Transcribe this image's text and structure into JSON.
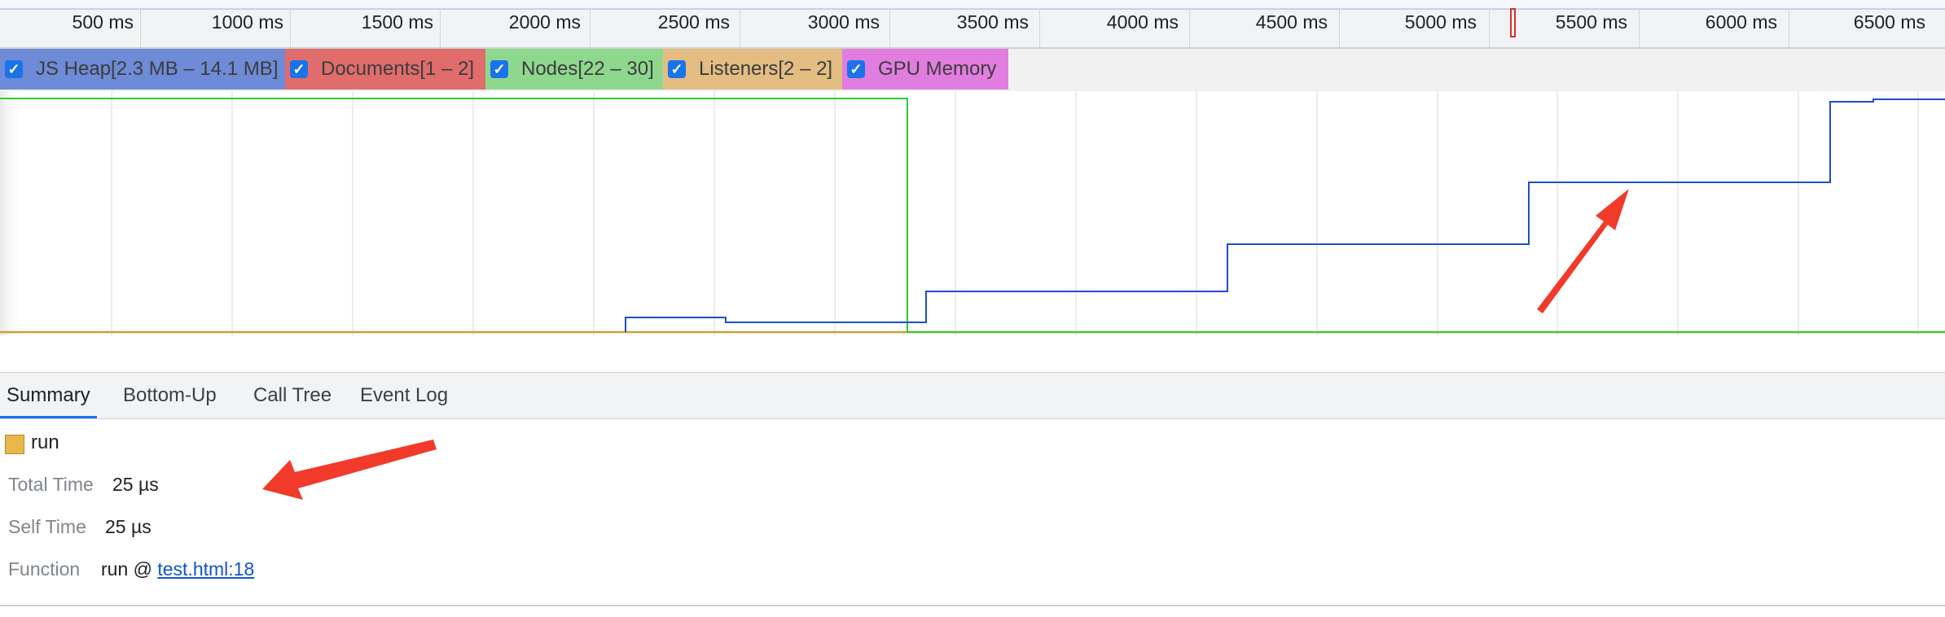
{
  "ruler": {
    "ticks": [
      "500 ms",
      "1000 ms",
      "1500 ms",
      "2000 ms",
      "2500 ms",
      "3000 ms",
      "3500 ms",
      "4000 ms",
      "4500 ms",
      "5000 ms",
      "5500 ms",
      "6000 ms",
      "6500 ms"
    ]
  },
  "legend": {
    "items": [
      {
        "label": "JS Heap[2.3 MB – 14.1 MB]",
        "checked": true,
        "color": "#6d8bd6"
      },
      {
        "label": "Documents[1 – 2]",
        "checked": true,
        "color": "#e06c6c"
      },
      {
        "label": "Nodes[22 – 30]",
        "checked": true,
        "color": "#8ed88e"
      },
      {
        "label": "Listeners[2 – 2]",
        "checked": true,
        "color": "#e3bd82"
      },
      {
        "label": "GPU Memory",
        "checked": true,
        "color": "#e27de0"
      }
    ]
  },
  "graph": {
    "colors": {
      "js_heap": "#1c4fc7",
      "documents": "#2fcc2f",
      "listeners": "#c9a13b"
    }
  },
  "tabs": [
    {
      "label": "Summary",
      "active": true
    },
    {
      "label": "Bottom-Up",
      "active": false
    },
    {
      "label": "Call Tree",
      "active": false
    },
    {
      "label": "Event Log",
      "active": false
    }
  ],
  "summary": {
    "title": "run",
    "swatch_color": "#e8b84a",
    "total_time_label": "Total Time",
    "total_time_value": "25 µs",
    "self_time_label": "Self Time",
    "self_time_value": "25 µs",
    "function_label": "Function",
    "function_prefix": "run @ ",
    "function_link": "test.html:18"
  }
}
